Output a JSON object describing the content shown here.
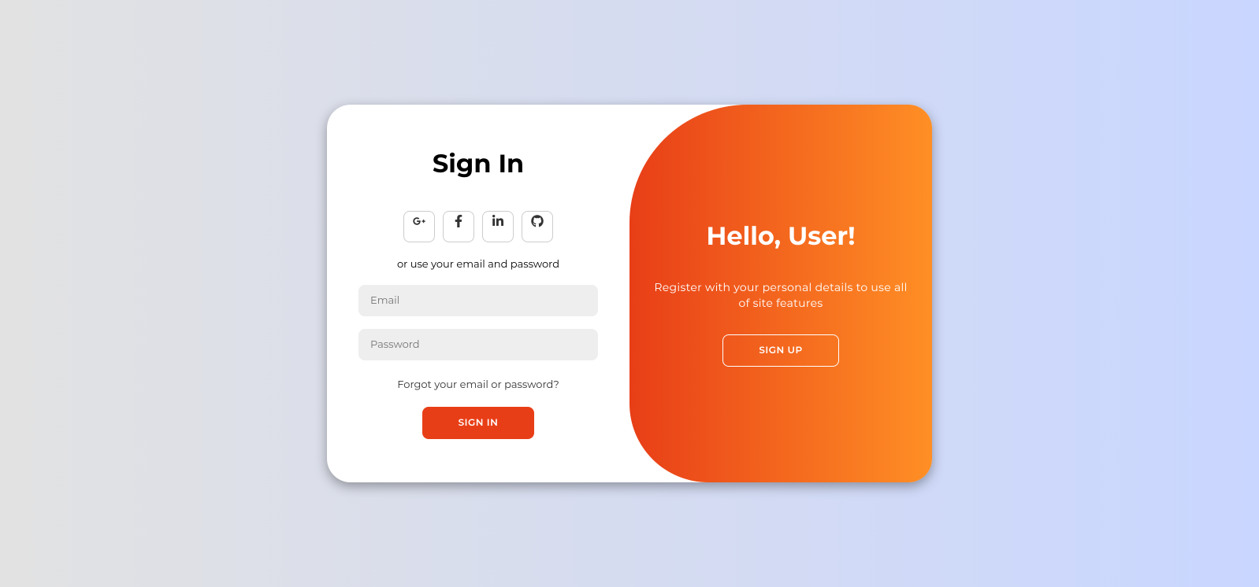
{
  "signIn": {
    "title": "Sign In",
    "socialText": "or use your email and password",
    "emailPlaceholder": "Email",
    "passwordPlaceholder": "Password",
    "forgotText": "Forgot your email or password?",
    "buttonText": "Sign In"
  },
  "toggle": {
    "title": "Hello, User!",
    "description": "Register with your personal details to use all of site features",
    "buttonText": "Sign Up"
  },
  "colors": {
    "primary": "#e83e17",
    "gradientEnd": "#ff8f25"
  }
}
